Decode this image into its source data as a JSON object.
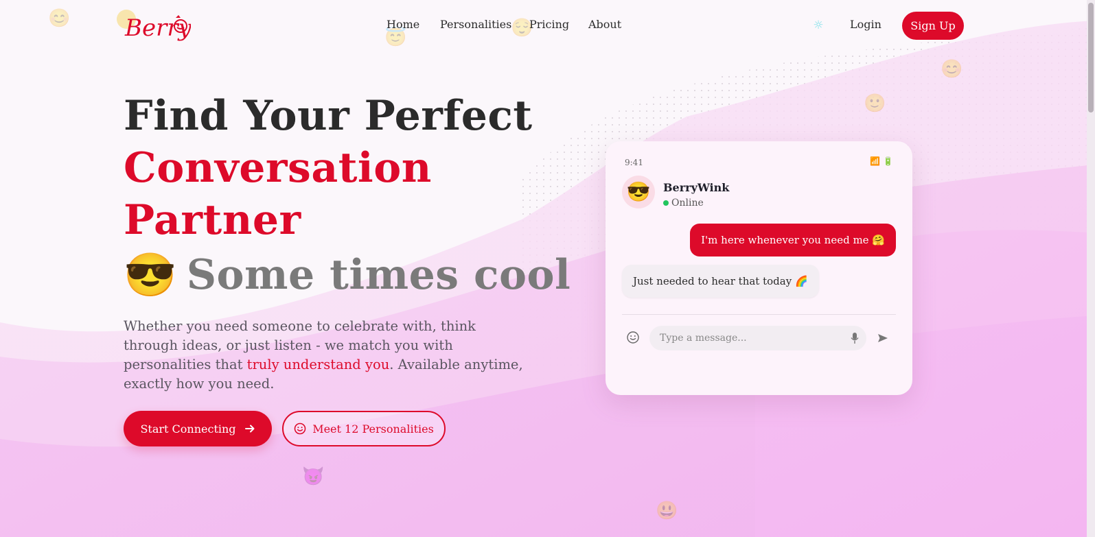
{
  "brand": {
    "name": "Berry"
  },
  "nav": {
    "items": [
      {
        "label": "Home"
      },
      {
        "label": "Personalities"
      },
      {
        "label": "Pricing"
      },
      {
        "label": "About"
      }
    ],
    "login_label": "Login",
    "signup_label": "Sign Up"
  },
  "hero": {
    "line1": "Find Your Perfect",
    "line2": "Conversation",
    "line3": "Partner",
    "line4_emoji": "😎",
    "line4_text": "Some times cool",
    "desc_part1": "Whether you need someone to celebrate with, think through ideas, or just listen - we match you with personalities that ",
    "desc_highlight": "truly understand you",
    "desc_part2": ". Available anytime, exactly how you need.",
    "primary_button": "Start Connecting",
    "secondary_button": "Meet 12 Personalities"
  },
  "chat": {
    "time": "9:41",
    "status_icons": "📶 🔋",
    "avatar_emoji": "😎",
    "contact_name": "BerryWink",
    "contact_status": "Online",
    "outgoing_message": "I'm here whenever you need me 🤗",
    "incoming_message": "Just needed to hear that today 🌈",
    "input_placeholder": "Type a message..."
  },
  "icons": {
    "theme_toggle": "sun-icon",
    "arrow": "arrow-right-icon",
    "smile": "smile-icon",
    "mic": "mic-icon",
    "send": "send-icon"
  },
  "colors": {
    "brand_red": "#dd0a2a",
    "background_pink": "#f5b3f2",
    "online_green": "#22c55e"
  }
}
